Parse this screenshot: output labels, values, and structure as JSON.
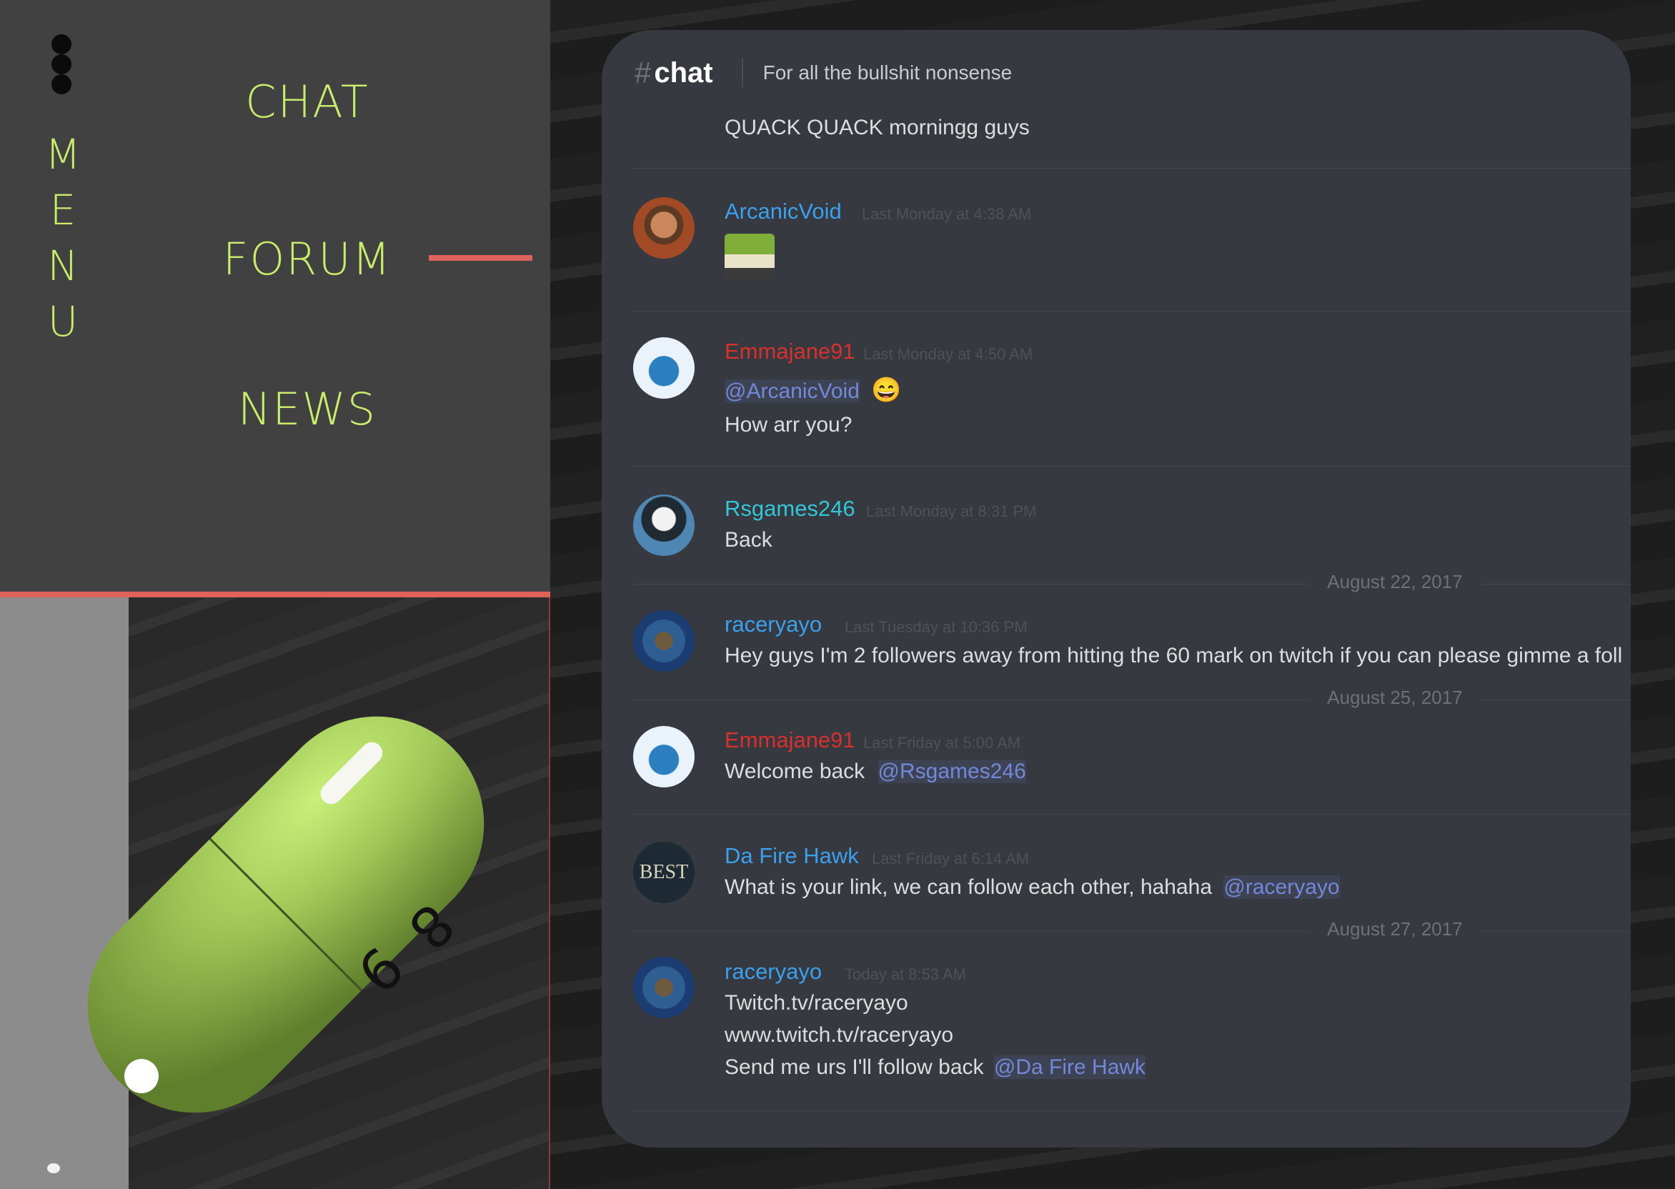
{
  "menu": {
    "letters": [
      "M",
      "E",
      "N",
      "U"
    ],
    "links": [
      "CHAT",
      "FORUM",
      "NEWS"
    ]
  },
  "logo": {
    "digits": [
      "8",
      "9",
      "9",
      "8"
    ]
  },
  "colors": {
    "accent_green": "#c7ed6a",
    "accent_red": "#e0625c",
    "chat_bg": "#36393f",
    "mention": "#7289da"
  },
  "chat": {
    "hash": "#",
    "channel": "chat",
    "topic": "For all the bullshit nonsense",
    "top_message": "QUACK QUACK morningg guys",
    "messages": [
      {
        "user": "ArcanicVoid",
        "time": "Last Monday at 4:38 AM"
      },
      {
        "user": "Emmajane91",
        "time": "Last Monday at 4:50 AM",
        "mention": "@ArcanicVoid",
        "emoji": "😄",
        "line": "How arr you?"
      },
      {
        "user": "Rsgames246",
        "time": "Last Monday at 8:31 PM",
        "line": "Back"
      },
      {
        "user": "raceryayo",
        "time": "Last Tuesday at 10:36 PM",
        "line": "Hey guys I'm 2 followers away from hitting the 60 mark on twitch if you can please gimme a foll"
      },
      {
        "user": "Emmajane91",
        "time": "Last Friday at 5:00 AM",
        "line": "Welcome back",
        "mention": "@Rsgames246"
      },
      {
        "user": "Da Fire Hawk",
        "time": "Last Friday at 6:14 AM",
        "line": "What is your link, we can follow each other, hahaha",
        "mention": "@raceryayo",
        "avatar_text": "BEST"
      },
      {
        "user": "raceryayo",
        "time": "Today at 8:53 AM",
        "lines": [
          "Twitch.tv/raceryayo",
          "www.twitch.tv/raceryayo",
          "Send me urs I'll follow back"
        ],
        "mention": "@Da Fire Hawk"
      }
    ],
    "dates": [
      "August 22, 2017",
      "August 25, 2017",
      "August 27, 2017"
    ]
  }
}
